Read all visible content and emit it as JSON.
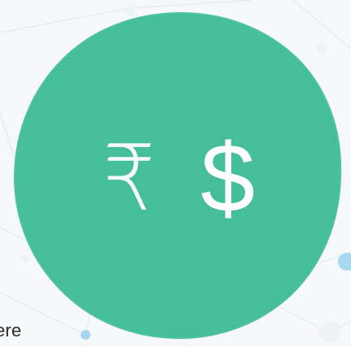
{
  "badge": {
    "rupee_symbol": "₹",
    "dollar_symbol": "$",
    "color": "#47be9a"
  },
  "background": {
    "partial_text": "ere"
  }
}
